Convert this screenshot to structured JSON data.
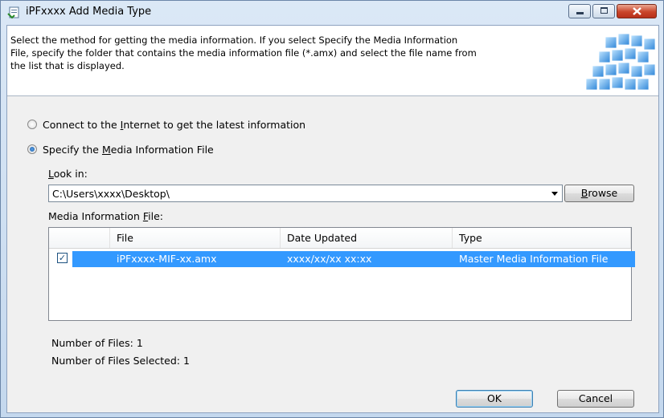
{
  "window": {
    "title": "iPFxxxx Add Media Type"
  },
  "header": {
    "line1": "Select the method for getting the media information. If you select Specify the Media Information",
    "line2": "File, specify the folder that contains the media information file (*.amx) and select the file name from",
    "line3": "the list that is displayed."
  },
  "options": {
    "internet_pre": "Connect to the ",
    "internet_key": "I",
    "internet_post": "nternet to get the latest information",
    "specify_pre": "Specify the ",
    "specify_key": "M",
    "specify_post": "edia Information File",
    "selected": "specify"
  },
  "lookin": {
    "label_key": "L",
    "label_post": "ook in:",
    "value": "C:\\Users\\xxxx\\Desktop\\",
    "browse_key": "B",
    "browse_post": "rowse"
  },
  "media_list": {
    "label_pre": "Media Information ",
    "label_key": "F",
    "label_post": "ile:",
    "columns": [
      "File",
      "Date Updated",
      "Type"
    ],
    "rows": [
      {
        "checked": true,
        "file": "iPFxxxx-MIF-xx.amx",
        "date": "xxxx/xx/xx xx:xx",
        "type": "Master Media Information File"
      }
    ]
  },
  "counts": {
    "files_label": "Number of Files: 1",
    "selected_label": "Number of Files Selected: 1"
  },
  "buttons": {
    "ok": "OK",
    "cancel": "Cancel"
  }
}
